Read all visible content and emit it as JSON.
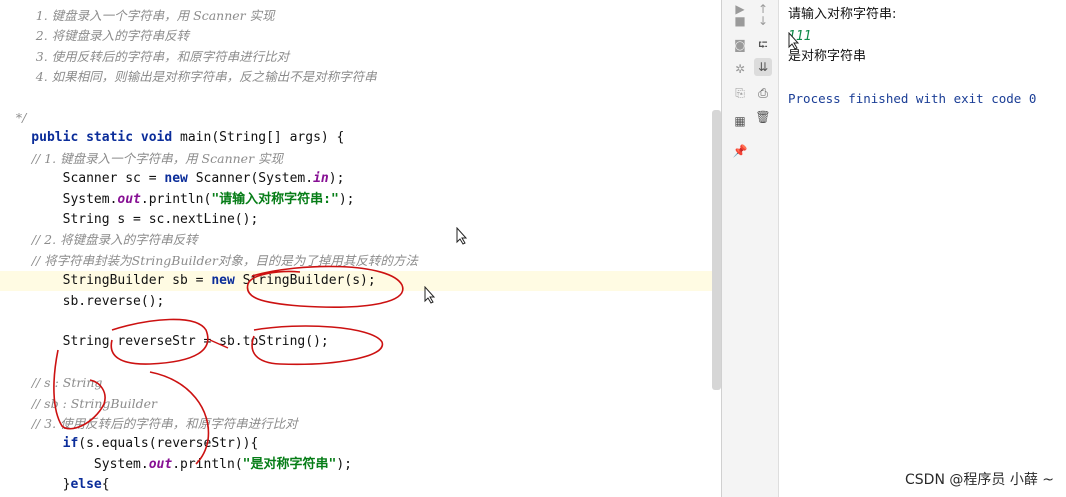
{
  "editor": {
    "lines": [
      {
        "tokens": [
          {
            "t": "         1. 键盘录入一个字符串，用 Scanner 实现",
            "c": "cmt"
          }
        ]
      },
      {
        "tokens": [
          {
            "t": "         2. 将键盘录入的字符串反转",
            "c": "cmt"
          }
        ]
      },
      {
        "tokens": [
          {
            "t": "         3. 使用反转后的字符串，和原字符串进行比对",
            "c": "cmt"
          }
        ]
      },
      {
        "tokens": [
          {
            "t": "         4. 如果相同，则输出是对称字符串，反之输出不是对称字符串",
            "c": "cmt"
          }
        ]
      },
      {
        "tokens": [
          {
            "t": "",
            "c": ""
          }
        ]
      },
      {
        "tokens": [
          {
            "t": "    */",
            "c": "cmt"
          }
        ]
      },
      {
        "tokens": [
          {
            "t": "    public static void ",
            "c": "kw"
          },
          {
            "t": "main(String[] args) {",
            "c": ""
          }
        ]
      },
      {
        "tokens": [
          {
            "t": "        // 1. 键盘录入一个字符串，用 Scanner 实现",
            "c": "cmt"
          }
        ]
      },
      {
        "tokens": [
          {
            "t": "        Scanner sc = ",
            "c": ""
          },
          {
            "t": "new ",
            "c": "kw"
          },
          {
            "t": "Scanner(System.",
            "c": ""
          },
          {
            "t": "in",
            "c": "fld"
          },
          {
            "t": ");",
            "c": ""
          }
        ]
      },
      {
        "tokens": [
          {
            "t": "        System.",
            "c": ""
          },
          {
            "t": "out",
            "c": "fld"
          },
          {
            "t": ".println(",
            "c": ""
          },
          {
            "t": "\"请输入对称字符串:\"",
            "c": "str"
          },
          {
            "t": ");",
            "c": ""
          }
        ]
      },
      {
        "tokens": [
          {
            "t": "        String s = sc.nextLine();",
            "c": ""
          }
        ]
      },
      {
        "tokens": [
          {
            "t": "        // 2. 将键盘录入的字符串反转",
            "c": "cmt"
          }
        ]
      },
      {
        "tokens": [
          {
            "t": "        // 将字符串封装为StringBuilder对象，目的是为了掉用其反转的方法",
            "c": "cmt"
          }
        ]
      },
      {
        "tokens": [
          {
            "t": "        StringBuilder sb = ",
            "c": ""
          },
          {
            "t": "new ",
            "c": "kw"
          },
          {
            "t": "StringBuilder(s);",
            "c": ""
          }
        ],
        "hl": true
      },
      {
        "tokens": [
          {
            "t": "        sb.reverse();",
            "c": ""
          }
        ]
      },
      {
        "tokens": [
          {
            "t": "",
            "c": ""
          }
        ]
      },
      {
        "tokens": [
          {
            "t": "        String reverseStr = sb.toString();",
            "c": ""
          }
        ]
      },
      {
        "tokens": [
          {
            "t": "",
            "c": ""
          }
        ]
      },
      {
        "tokens": [
          {
            "t": "        // s : String",
            "c": "cmt"
          }
        ]
      },
      {
        "tokens": [
          {
            "t": "        // sb : StringBuilder",
            "c": "cmt"
          }
        ]
      },
      {
        "tokens": [
          {
            "t": "        // 3. 使用反转后的字符串，和原字符串进行比对",
            "c": "cmt"
          }
        ]
      },
      {
        "tokens": [
          {
            "t": "        ",
            "c": ""
          },
          {
            "t": "if",
            "c": "kw"
          },
          {
            "t": "(s.equals(reverseStr)){",
            "c": ""
          }
        ]
      },
      {
        "tokens": [
          {
            "t": "            System.",
            "c": ""
          },
          {
            "t": "out",
            "c": "fld"
          },
          {
            "t": ".println(",
            "c": ""
          },
          {
            "t": "\"是对称字符串\"",
            "c": "str"
          },
          {
            "t": ");",
            "c": ""
          }
        ]
      },
      {
        "tokens": [
          {
            "t": "        }",
            "c": ""
          },
          {
            "t": "else",
            "c": "kw"
          },
          {
            "t": "{",
            "c": ""
          }
        ]
      }
    ]
  },
  "console": {
    "prompt": "请输入对称字符串:",
    "input": "111",
    "result": "是对称字符串",
    "finished": "Process finished with exit code 0"
  },
  "toolbar": {
    "icons": [
      "play-icon",
      "stop-icon",
      "arrow-down-icon",
      "camera-icon",
      "soft-wrap-icon",
      "debug-icon",
      "scroll-to-end-icon",
      "restore-icon",
      "print-icon",
      "layout-icon",
      "trash-icon",
      "pin-icon"
    ]
  },
  "watermark": "CSDN @程序员 小薛 ~",
  "colors": {
    "keyword": "#0b2d9a",
    "string": "#067d17",
    "field": "#871094",
    "comment": "#8c8c8c",
    "console_input": "#0f8a4a",
    "console_finish": "#1b3e96",
    "annotation": "#cc1111",
    "highlight_line": "#fffbe3"
  }
}
